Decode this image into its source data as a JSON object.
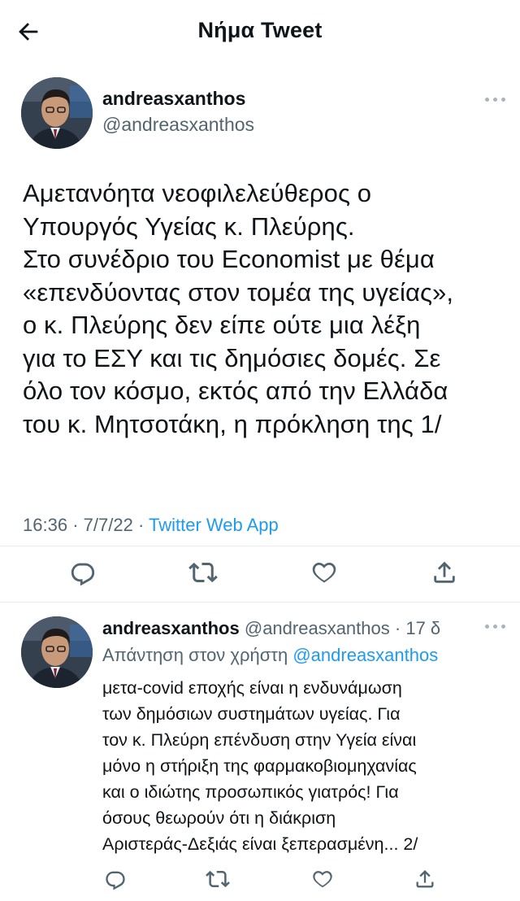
{
  "header": {
    "title": "Νήμα Tweet"
  },
  "main_tweet": {
    "author_name": "andreasxanthos",
    "author_handle": "@andreasxanthos",
    "text_lines": [
      "Αμετανόητα νεοφιλελεύθερος ο",
      "Υπουργός Υγείας κ. Πλεύρης.",
      "Στο συνέδριο του Economist με θέμα",
      "«επενδύοντας στον τομέα της υγείας»,",
      "ο κ. Πλεύρης δεν είπε ούτε μια λέξη",
      "για το ΕΣΥ και τις δημόσιες δομές. Σε",
      "όλο τον κόσμο, εκτός από την Ελλάδα",
      "του κ. Μητσοτάκη, η πρόκληση της 1/"
    ],
    "time": "16:36",
    "date": "7/7/22",
    "separator": "·",
    "source": "Twitter Web App"
  },
  "reply_tweet": {
    "author_name": "andreasxanthos",
    "author_handle": "@andreasxanthos",
    "separator": "·",
    "age": "17 δ",
    "replying_to_label": "Απάντηση στον χρήστη",
    "replying_to_handle": "@andreasxanthos",
    "text_lines": [
      "μετα-covid εποχής είναι η ενδυνάμωση",
      "των δημόσιων συστημάτων υγείας. Για",
      "τον κ. Πλεύρη επένδυση στην Υγεία είναι",
      "μόνο η στήριξη της φαρμακοβιομηχανίας",
      "και ο ιδιώτης προσωπικός γιατρός! Για",
      "όσους θεωρούν ότι η διάκριση",
      "Αριστεράς-Δεξιάς είναι ξεπερασμένη... 2/"
    ]
  },
  "icons": {
    "back": "arrow-left-icon",
    "more": "more-horizontal-icon",
    "reply": "reply-icon",
    "retweet": "retweet-icon",
    "like": "heart-icon",
    "share": "share-icon"
  },
  "colors": {
    "text": "#0f1419",
    "secondary": "#536471",
    "accent": "#1d9bf0",
    "divider": "#e6ecf0"
  }
}
